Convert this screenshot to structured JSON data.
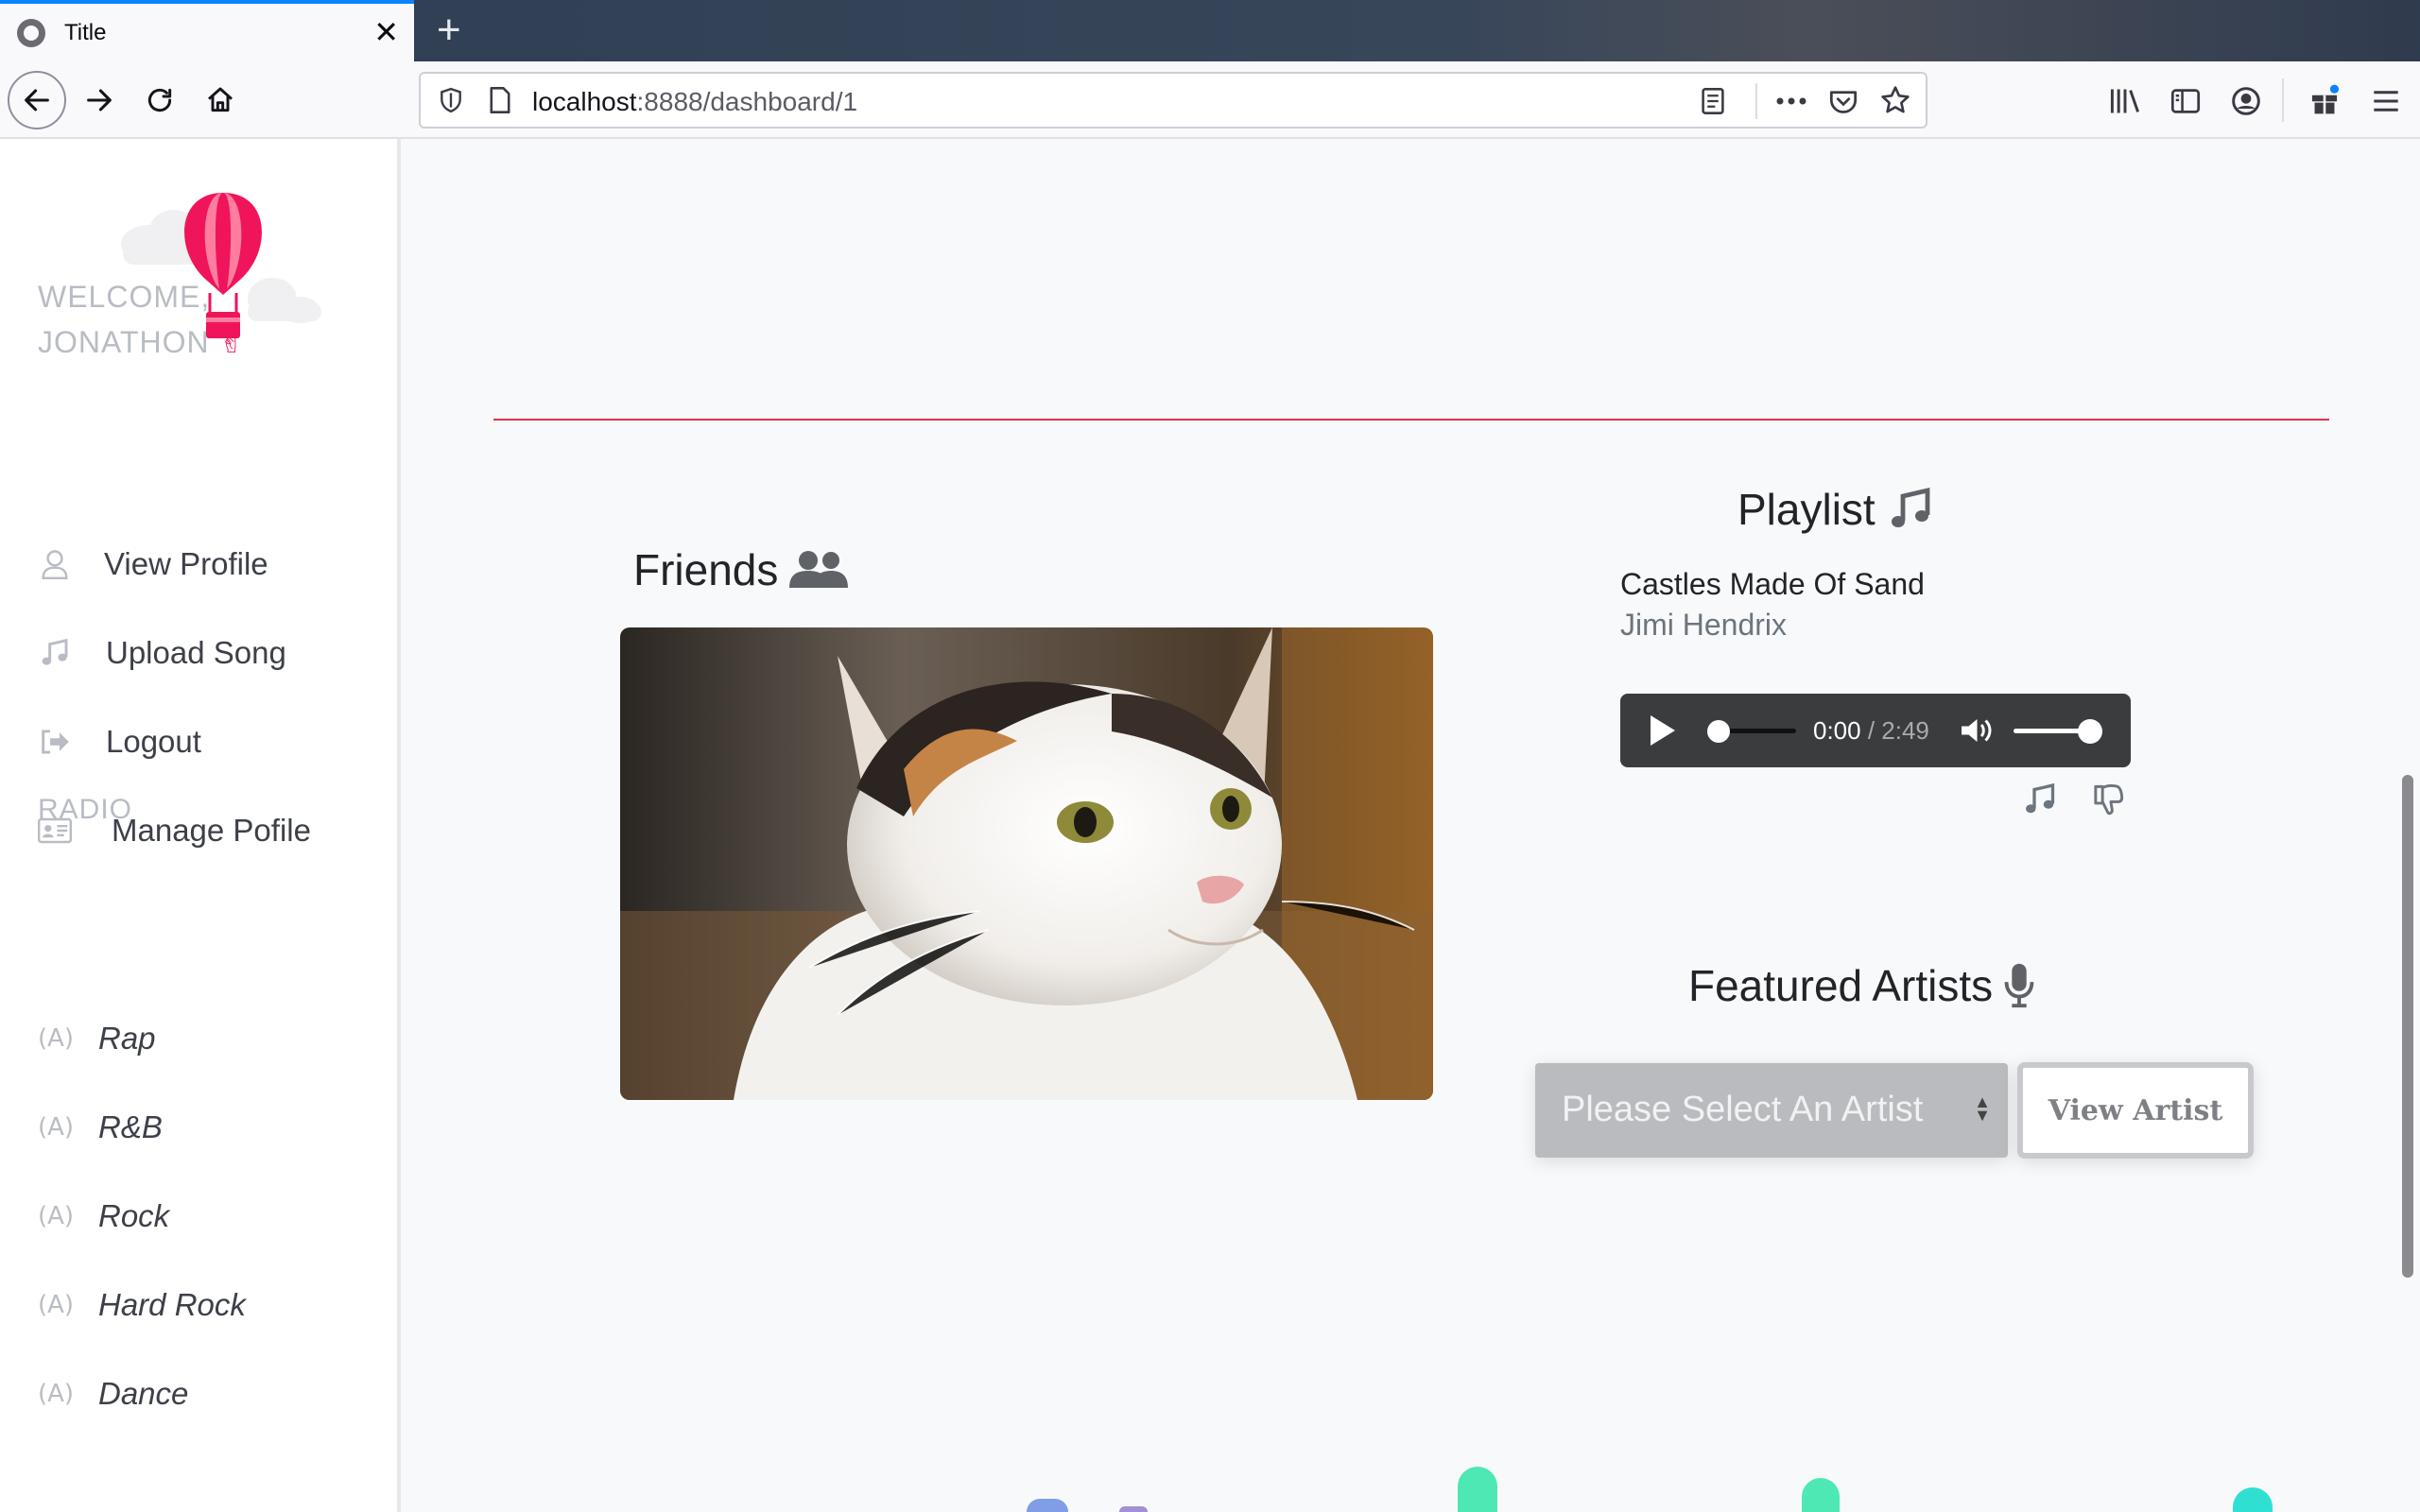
{
  "browser": {
    "tab_title": "Title",
    "new_tab_symbol": "+",
    "url_host": "localhost",
    "url_rest": ":8888/dashboard/1"
  },
  "sidebar": {
    "welcome_line1": "WELCOME,",
    "welcome_line2": "JONATHON",
    "welcome_emoji": "✌",
    "menu": [
      {
        "label": "View Profile",
        "icon": "user-icon"
      },
      {
        "label": "Upload Song",
        "icon": "music-note-icon"
      },
      {
        "label": "Logout",
        "icon": "logout-icon"
      },
      {
        "label": "Manage Pofile",
        "icon": "id-card-icon"
      }
    ],
    "radio_heading": "RADIO",
    "radio": [
      {
        "label": "Rap",
        "icon": "broadcast-icon"
      },
      {
        "label": "R&B",
        "icon": "broadcast-icon"
      },
      {
        "label": "Rock",
        "icon": "broadcast-icon"
      },
      {
        "label": "Hard Rock",
        "icon": "broadcast-icon"
      },
      {
        "label": "Dance",
        "icon": "broadcast-icon"
      }
    ]
  },
  "main": {
    "friends_heading": "Friends",
    "playlist_heading": "Playlist",
    "song": {
      "title": "Castles Made Of Sand",
      "artist": "Jimi Hendrix"
    },
    "player": {
      "current_time": "0:00",
      "separator": " / ",
      "duration": "2:49",
      "progress": 0,
      "volume": 1.0
    },
    "featured_heading": "Featured Artists",
    "artist_select_placeholder": "Please Select An Artist",
    "view_artist_label": "View Artist"
  },
  "colors": {
    "accent_red": "#dc3545",
    "balloon_pink": "#f0145a",
    "chrome_blue": "#0a84ff",
    "blob_green": "#4de8b4",
    "blob_teal": "#2fe0d2",
    "blob_blue": "#7f9ee6",
    "blob_purple": "#a38fd6"
  }
}
